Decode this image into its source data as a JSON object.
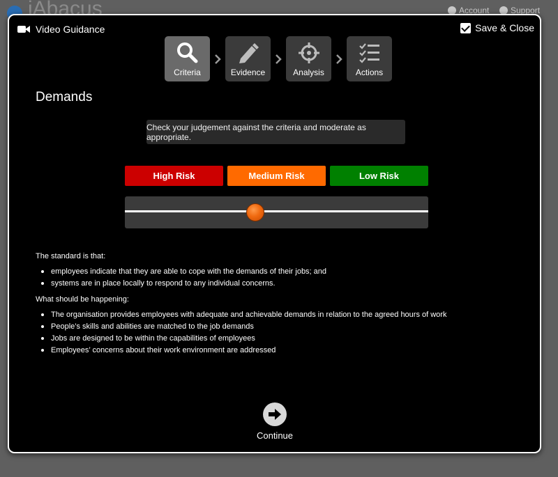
{
  "app": {
    "logo_text": "iAbacus",
    "account_label": "Account",
    "support_label": "Support"
  },
  "modal": {
    "video_guidance_label": "Video Guidance",
    "save_close_label": "Save & Close",
    "save_close_checked": true
  },
  "steps": [
    {
      "label": "Criteria",
      "icon": "search-icon",
      "active": true
    },
    {
      "label": "Evidence",
      "icon": "pencil-icon",
      "active": false
    },
    {
      "label": "Analysis",
      "icon": "crosshair-icon",
      "active": false
    },
    {
      "label": "Actions",
      "icon": "checklist-icon",
      "active": false
    }
  ],
  "section_title": "Demands",
  "instruction": "Check your judgement against the criteria and moderate as appropriate.",
  "risk": {
    "high_label": "High Risk",
    "medium_label": "Medium Risk",
    "low_label": "Low Risk",
    "high_color": "#cc0000",
    "medium_color": "#ff6a00",
    "low_color": "#008000",
    "slider_value_fraction": 0.43
  },
  "standard": {
    "heading": "The standard is that:",
    "items": [
      "employees indicate that they are able to cope with the demands of their jobs; and",
      "systems are in place locally to respond to any individual concerns."
    ]
  },
  "happening": {
    "heading": "What should be happening:",
    "items": [
      "The organisation provides employees with adequate and achievable demands in relation to the agreed hours of work",
      "People’s skills and abilities are matched to the job demands",
      "Jobs are designed to be within the capabilities of employees",
      "Employees’ concerns about their work environment are addressed"
    ]
  },
  "continue_label": "Continue"
}
